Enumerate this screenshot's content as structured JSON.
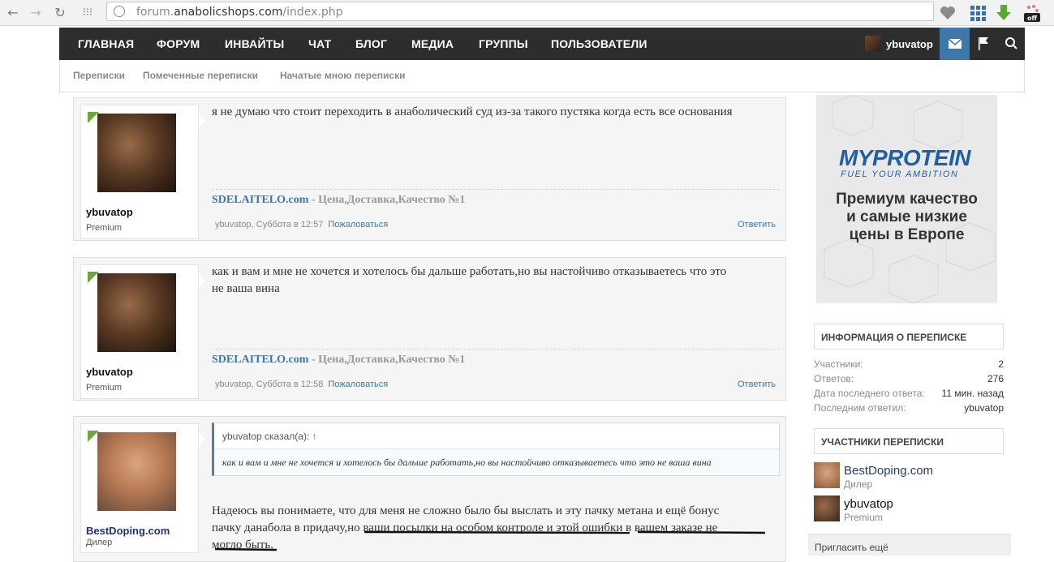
{
  "browser": {
    "url_prefix": "forum.",
    "url_domain": "anabolicshops.com",
    "url_path": "/index.php",
    "ext_badge": "off"
  },
  "nav": {
    "items": [
      "ГЛАВНАЯ",
      "ФОРУМ",
      "ИНВАЙТЫ",
      "ЧАТ",
      "БЛОГ",
      "МЕДИА",
      "ГРУППЫ",
      "ПОЛЬЗОВАТЕЛИ"
    ],
    "username": "ybuvatop"
  },
  "subnav": {
    "tabs": [
      "Переписки",
      "Помеченные переписки",
      "Начатые мною переписки"
    ]
  },
  "posts": [
    {
      "author": "ybuvatop",
      "role": "Premium",
      "message": "я не думаю что стоит переходить в анаболический суд из-за такого пустяка когда есть все основания",
      "sig_link": "SDELAITELO.com",
      "sig_rest": " - Цена,Доставка,Качество №1",
      "meta": "ybuvatop, Суббота в 12:57",
      "report": "Пожаловаться",
      "reply": "Ответить"
    },
    {
      "author": "ybuvatop",
      "role": "Premium",
      "message_line1": "как и вам и мне не хочется и хотелось бы дальше работать,но вы настойчиво отказываетесь что это",
      "message_line2": "не ваша вина",
      "sig_link": "SDELAITELO.com",
      "sig_rest": " - Цена,Доставка,Качество №1",
      "meta": "ybuvatop, Суббота в 12:58",
      "report": "Пожаловаться",
      "reply": "Ответить"
    },
    {
      "author": "BestDoping.com",
      "role": "Дилер",
      "quote_head": "ybuvatop сказал(а):",
      "quote_arrow": "↑",
      "quote_body": "как и вам и мне не хочется и хотелось бы дальше работать,но вы настойчиво отказываетесь что это не ваша вина",
      "message_line1": "Надеюсь вы понимаете, что для меня не сложно было бы выслать и эту пачку метана и ещё бонус",
      "message_line2": "пачку данабола в придачу,но ваши посылки на особом контроле и этой ошибки в вашем заказе не",
      "message_line3": "могло быть."
    }
  ],
  "ad": {
    "logo": "MYPROTEIN",
    "tagline": "FUEL YOUR AMBITION",
    "line1": "Премиум качество",
    "line2": "и самые низкие",
    "line3": "цены в Европе"
  },
  "info": {
    "title": "ИНФОРМАЦИЯ О ПЕРЕПИСКЕ",
    "rows": [
      {
        "label": "Участники:",
        "value": "2"
      },
      {
        "label": "Ответов:",
        "value": "276"
      },
      {
        "label": "Дата последнего ответа:",
        "value": "11 мин. назад"
      },
      {
        "label": "Последним ответил:",
        "value": "ybuvatop"
      }
    ]
  },
  "participants": {
    "title": "УЧАСТНИКИ ПЕРЕПИСКИ",
    "list": [
      {
        "name": "BestDoping.com",
        "role": "Дилер"
      },
      {
        "name": "ybuvatop",
        "role": "Premium"
      }
    ],
    "invite": "Пригласить ещё"
  }
}
